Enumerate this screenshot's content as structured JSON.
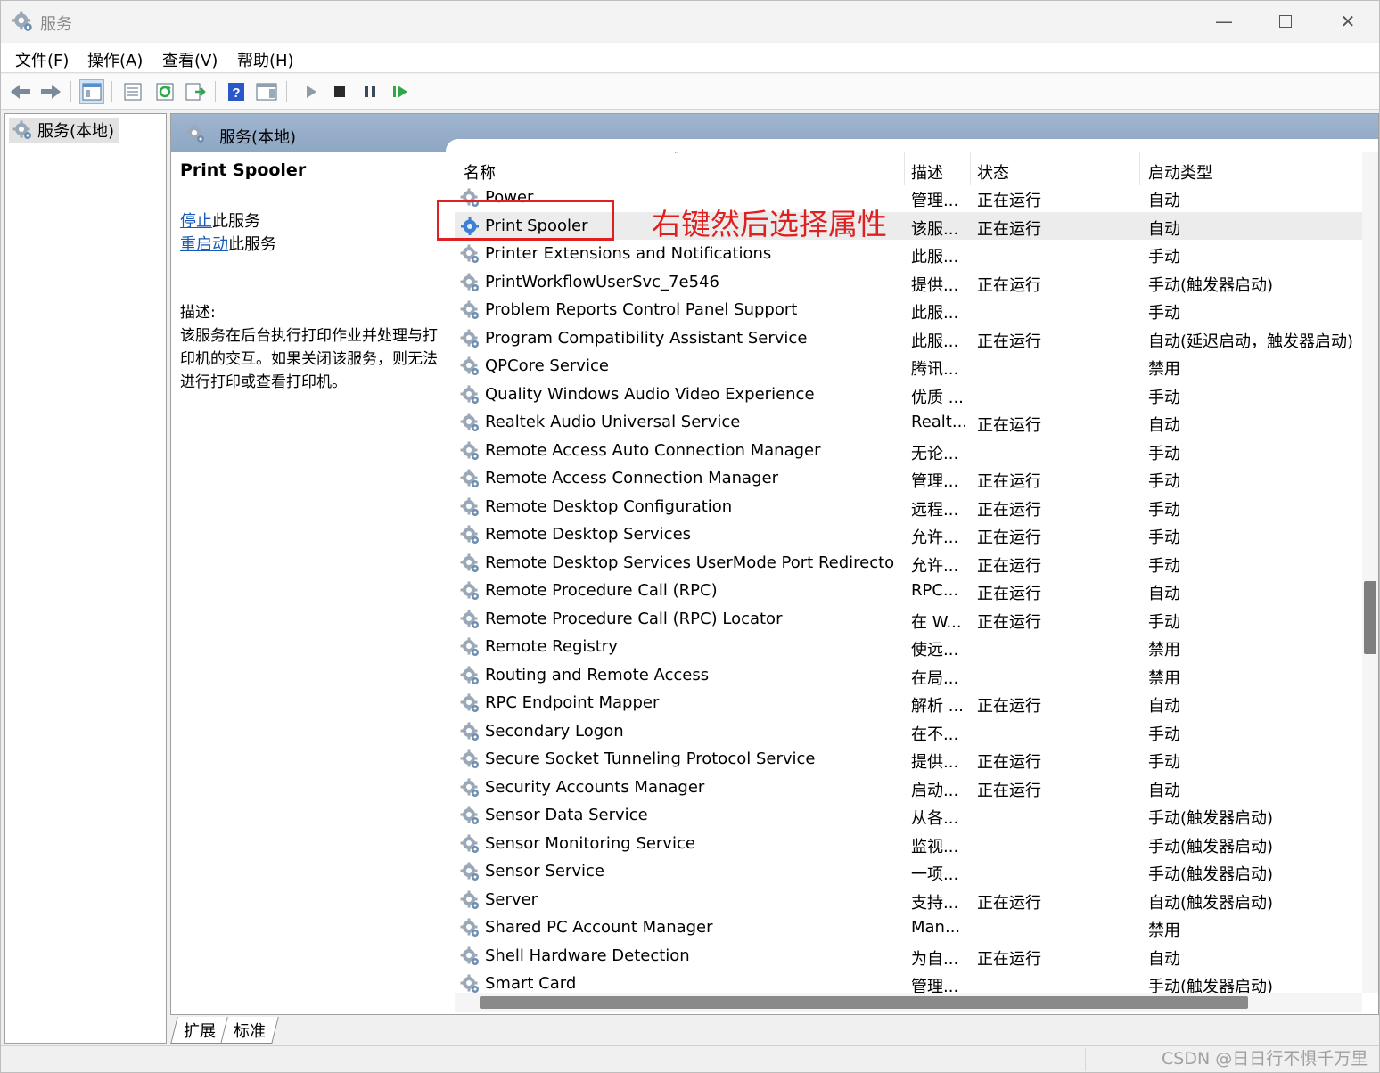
{
  "window": {
    "title": "服务"
  },
  "menu": [
    "文件(F)",
    "操作(A)",
    "查看(V)",
    "帮助(H)"
  ],
  "tree": {
    "root": "服务(本地)"
  },
  "main": {
    "header": "服务(本地)"
  },
  "detail": {
    "name": "Print Spooler",
    "stop_link": "停止",
    "stop_suffix": "此服务",
    "restart_link": "重启动",
    "restart_suffix": "此服务",
    "desc_label": "描述:",
    "desc_text": "该服务在后台执行打印作业并处理与打印机的交互。如果关闭该服务，则无法进行打印或查看打印机。"
  },
  "columns": {
    "name": "名称",
    "desc": "描述",
    "status": "状态",
    "type": "启动类型"
  },
  "services": [
    {
      "name": "Power",
      "desc": "管理...",
      "status": "正在运行",
      "type": "自动"
    },
    {
      "name": "Print Spooler",
      "desc": "该服...",
      "status": "正在运行",
      "type": "自动",
      "selected": true
    },
    {
      "name": "Printer Extensions and Notifications",
      "desc": "此服...",
      "status": "",
      "type": "手动"
    },
    {
      "name": "PrintWorkflowUserSvc_7e546",
      "desc": "提供...",
      "status": "正在运行",
      "type": "手动(触发器启动)"
    },
    {
      "name": "Problem Reports Control Panel Support",
      "desc": "此服...",
      "status": "",
      "type": "手动"
    },
    {
      "name": "Program Compatibility Assistant Service",
      "desc": "此服...",
      "status": "正在运行",
      "type": "自动(延迟启动，触发器启动)"
    },
    {
      "name": "QPCore Service",
      "desc": "腾讯...",
      "status": "",
      "type": "禁用"
    },
    {
      "name": "Quality Windows Audio Video Experience",
      "desc": "优质 ...",
      "status": "",
      "type": "手动"
    },
    {
      "name": "Realtek Audio Universal Service",
      "desc": "Realt...",
      "status": "正在运行",
      "type": "自动"
    },
    {
      "name": "Remote Access Auto Connection Manager",
      "desc": "无论...",
      "status": "",
      "type": "手动"
    },
    {
      "name": "Remote Access Connection Manager",
      "desc": "管理...",
      "status": "正在运行",
      "type": "手动"
    },
    {
      "name": "Remote Desktop Configuration",
      "desc": "远程...",
      "status": "正在运行",
      "type": "手动"
    },
    {
      "name": "Remote Desktop Services",
      "desc": "允许...",
      "status": "正在运行",
      "type": "手动"
    },
    {
      "name": "Remote Desktop Services UserMode Port Redirector",
      "desc": "允许...",
      "status": "正在运行",
      "type": "手动"
    },
    {
      "name": "Remote Procedure Call (RPC)",
      "desc": "RPC...",
      "status": "正在运行",
      "type": "自动"
    },
    {
      "name": "Remote Procedure Call (RPC) Locator",
      "desc": "在 W...",
      "status": "正在运行",
      "type": "手动"
    },
    {
      "name": "Remote Registry",
      "desc": "使远...",
      "status": "",
      "type": "禁用"
    },
    {
      "name": "Routing and Remote Access",
      "desc": "在局...",
      "status": "",
      "type": "禁用"
    },
    {
      "name": "RPC Endpoint Mapper",
      "desc": "解析 ...",
      "status": "正在运行",
      "type": "自动"
    },
    {
      "name": "Secondary Logon",
      "desc": "在不...",
      "status": "",
      "type": "手动"
    },
    {
      "name": "Secure Socket Tunneling Protocol Service",
      "desc": "提供...",
      "status": "正在运行",
      "type": "手动"
    },
    {
      "name": "Security Accounts Manager",
      "desc": "启动...",
      "status": "正在运行",
      "type": "自动"
    },
    {
      "name": "Sensor Data Service",
      "desc": "从各...",
      "status": "",
      "type": "手动(触发器启动)"
    },
    {
      "name": "Sensor Monitoring Service",
      "desc": "监视...",
      "status": "",
      "type": "手动(触发器启动)"
    },
    {
      "name": "Sensor Service",
      "desc": "一项...",
      "status": "",
      "type": "手动(触发器启动)"
    },
    {
      "name": "Server",
      "desc": "支持...",
      "status": "正在运行",
      "type": "自动(触发器启动)"
    },
    {
      "name": "Shared PC Account Manager",
      "desc": "Man...",
      "status": "",
      "type": "禁用"
    },
    {
      "name": "Shell Hardware Detection",
      "desc": "为自...",
      "status": "正在运行",
      "type": "自动"
    },
    {
      "name": "Smart Card",
      "desc": "管理...",
      "status": "",
      "type": "手动(触发器启动)"
    }
  ],
  "bottom_tabs": [
    "扩展",
    "标准"
  ],
  "annotation": "右键然后选择属性",
  "watermark": "CSDN @日日行不惧千万里",
  "colors": {
    "accent_red": "#e02020",
    "header_blue": "#9fb5cf",
    "link_blue": "#1a5ab8"
  }
}
